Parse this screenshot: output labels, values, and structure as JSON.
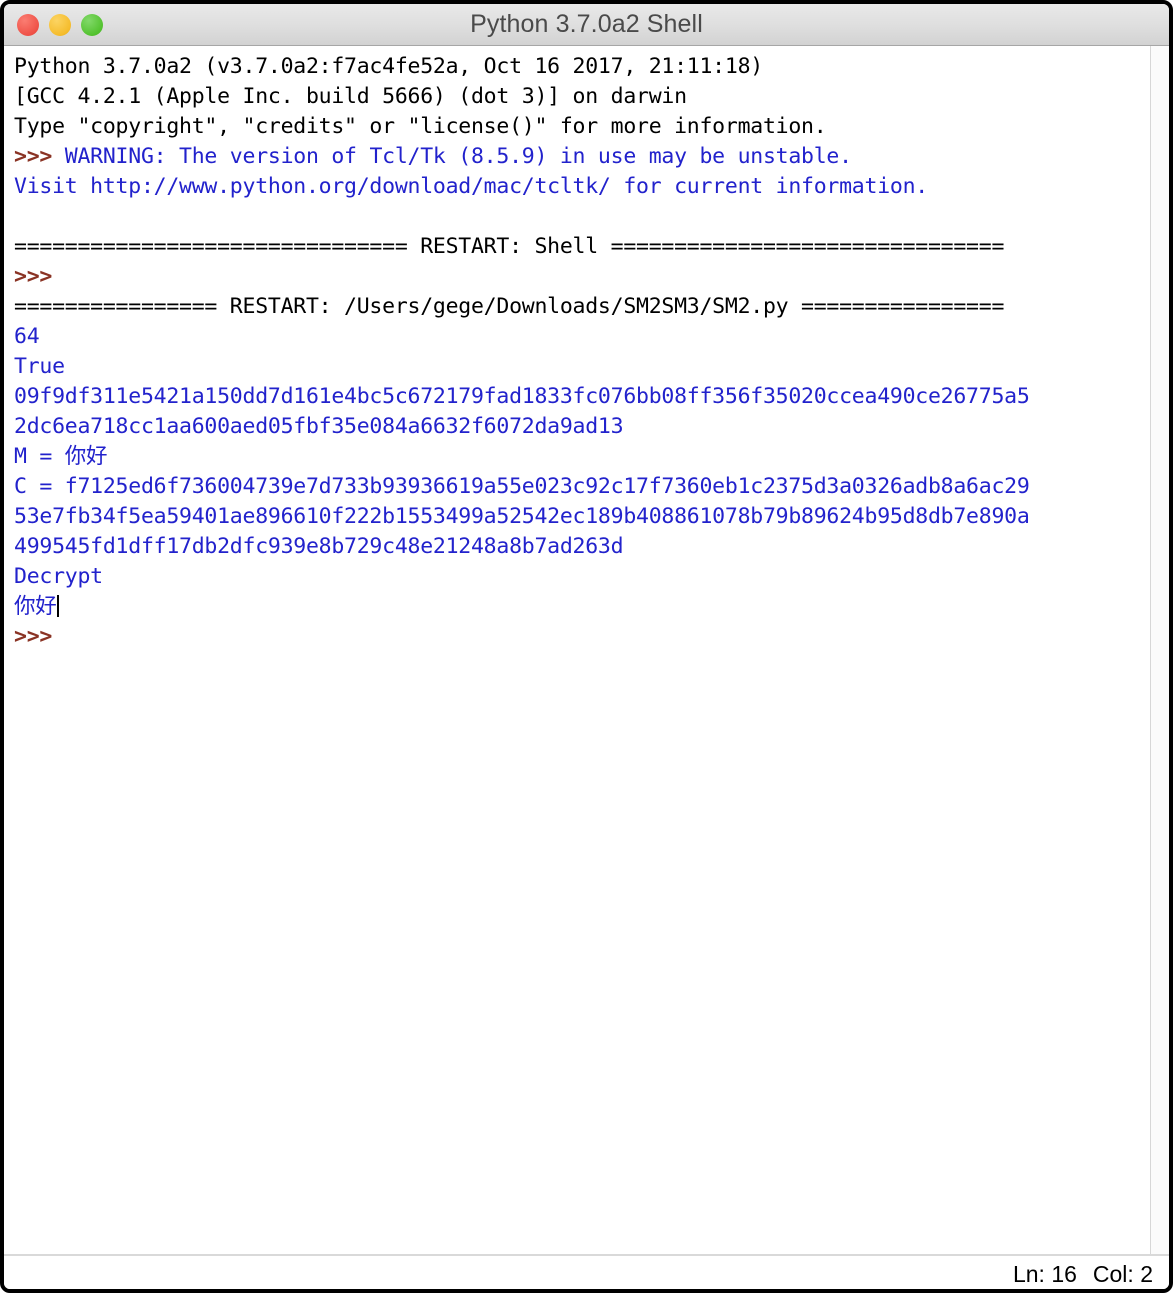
{
  "window": {
    "title": "Python 3.7.0a2 Shell",
    "controls": {
      "close_label": "close",
      "minimize_label": "minimize",
      "zoom_label": "zoom"
    }
  },
  "shell": {
    "lines": [
      {
        "id": "banner-version",
        "color": "black",
        "text": "Python 3.7.0a2 (v3.7.0a2:f7ac4fe52a, Oct 16 2017, 21:11:18)"
      },
      {
        "id": "banner-compiler",
        "color": "black",
        "text": "[GCC 4.2.1 (Apple Inc. build 5666) (dot 3)] on darwin"
      },
      {
        "id": "banner-help",
        "color": "black",
        "text": "Type \"copyright\", \"credits\" or \"license()\" for more information."
      },
      {
        "id": "warning-tcltk",
        "prompt": ">>> ",
        "color": "blue",
        "text": "WARNING: The version of Tcl/Tk (8.5.9) in use may be unstable."
      },
      {
        "id": "warning-visit",
        "color": "blue",
        "text": "Visit http://www.python.org/download/mac/tcltk/ for current information."
      },
      {
        "id": "spacer-1",
        "color": "black",
        "text": ""
      },
      {
        "id": "restart-shell",
        "color": "black",
        "text": "=============================== RESTART: Shell ==============================="
      },
      {
        "id": "prompt-1",
        "prompt": ">>>",
        "color": "black",
        "text": ""
      },
      {
        "id": "restart-file",
        "color": "black",
        "text": "================ RESTART: /Users/gege/Downloads/SM2SM3/SM2.py ================"
      },
      {
        "id": "output-keysize",
        "color": "blue",
        "text": "64"
      },
      {
        "id": "output-true",
        "color": "blue",
        "text": "True"
      },
      {
        "id": "output-hash-1",
        "color": "blue",
        "text": "09f9df311e5421a150dd7d161e4bc5c672179fad1833fc076bb08ff356f35020ccea490ce26775a5"
      },
      {
        "id": "output-hash-2",
        "color": "blue",
        "text": "2dc6ea718cc1aa600aed05fbf35e084a6632f6072da9ad13"
      },
      {
        "id": "output-m",
        "color": "blue",
        "text": "M = 你好"
      },
      {
        "id": "output-c-1",
        "color": "blue",
        "text": "C = f7125ed6f736004739e7d733b93936619a55e023c92c17f7360eb1c2375d3a0326adb8a6ac29"
      },
      {
        "id": "output-c-2",
        "color": "blue",
        "text": "53e7fb34f5ea59401ae896610f222b1553499a52542ec189b408861078b79b89624b95d8db7e890a"
      },
      {
        "id": "output-c-3",
        "color": "blue",
        "text": "499545fd1dff17db2dfc939e8b729c48e21248a8b7ad263d"
      },
      {
        "id": "output-decrypt-label",
        "color": "blue",
        "text": "Decrypt"
      },
      {
        "id": "output-decrypted",
        "color": "blue",
        "text": "你好",
        "caret": true
      },
      {
        "id": "prompt-2",
        "prompt": ">>>",
        "color": "black",
        "text": ""
      }
    ]
  },
  "statusbar": {
    "line_label": "Ln: 16",
    "column_label": "Col: 2"
  },
  "colors": {
    "output_blue": "#2222cc",
    "prompt_brown": "#8a3324",
    "text_black": "#000000",
    "titlebar_gray": "#dedede",
    "close_red": "#ef5147",
    "minimize_yellow": "#f5bc2c",
    "zoom_green": "#53c22f"
  }
}
